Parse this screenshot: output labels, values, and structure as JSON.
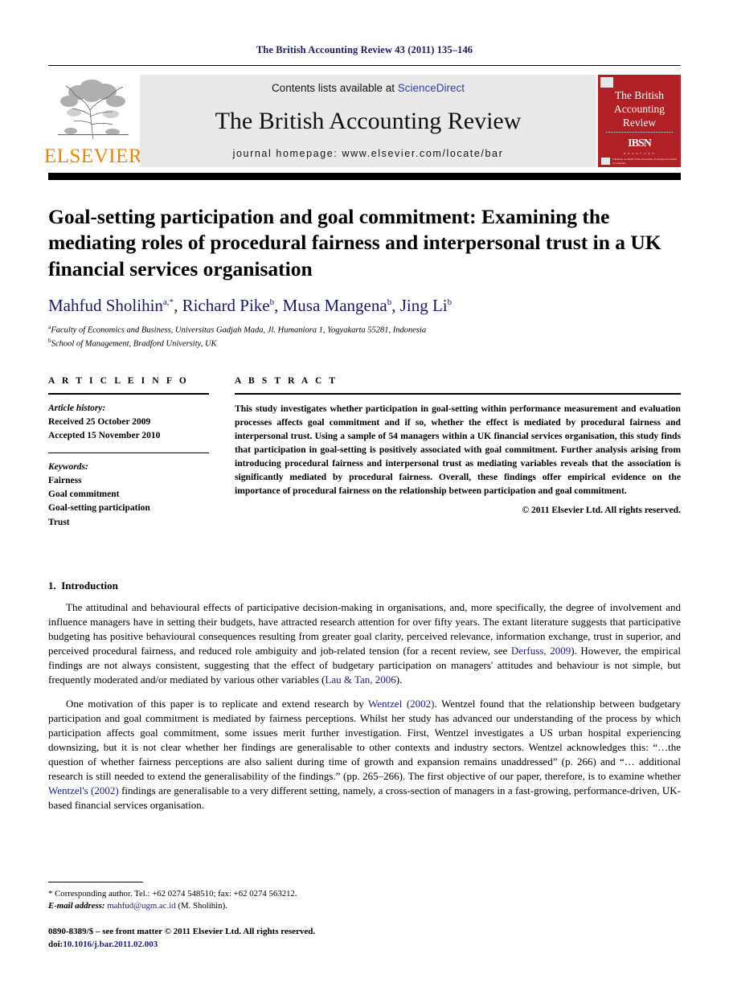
{
  "running_head": "The British Accounting Review 43 (2011) 135–146",
  "masthead": {
    "publisher_logo_text": "ELSEVIER",
    "contents_line_prefix": "Contents lists available at ",
    "contents_link": "ScienceDirect",
    "journal_title": "The British Accounting Review",
    "homepage_line": "journal homepage: www.elsevier.com/locate/bar",
    "cover": {
      "title_line1": "The British",
      "title_line2": "Accounting",
      "title_line3": "Review",
      "logo_text": "IBSN",
      "logo_sub": "B R A D F O R D",
      "footer_text": "Published on behalf of the association of Chartered Certified Accountants"
    }
  },
  "article": {
    "title": "Goal-setting participation and goal commitment: Examining the mediating roles of procedural fairness and interpersonal trust in a UK financial services organisation",
    "authors": [
      {
        "name": "Mahfud Sholihin",
        "marks": "a,*"
      },
      {
        "name": "Richard Pike",
        "marks": "b"
      },
      {
        "name": "Musa Mangena",
        "marks": "b"
      },
      {
        "name": "Jing Li",
        "marks": "b"
      }
    ],
    "affiliations": [
      {
        "mark": "a",
        "text": "Faculty of Economics and Business, Universitas Gadjah Mada, Jl. Humaniora 1, Yogyakarta 55281, Indonesia"
      },
      {
        "mark": "b",
        "text": "School of Management, Bradford University, UK"
      }
    ]
  },
  "info": {
    "label": "A R T I C L E   I N F O",
    "history_heading": "Article history:",
    "received": "Received 25 October 2009",
    "accepted": "Accepted 15 November 2010",
    "keywords_heading": "Keywords:",
    "keywords": [
      "Fairness",
      "Goal commitment",
      "Goal-setting participation",
      "Trust"
    ]
  },
  "abstract": {
    "label": "A B S T R A C T",
    "text": "This study investigates whether participation in goal-setting within performance measurement and evaluation processes affects goal commitment and if so, whether the effect is mediated by procedural fairness and interpersonal trust. Using a sample of 54 managers within a UK financial services organisation, this study finds that participation in goal-setting is positively associated with goal commitment. Further analysis arising from introducing procedural fairness and interpersonal trust as mediating variables reveals that the association is significantly mediated by procedural fairness. Overall, these findings offer empirical evidence on the importance of procedural fairness on the relationship between participation and goal commitment.",
    "copyright": "© 2011 Elsevier Ltd. All rights reserved."
  },
  "body": {
    "section_number": "1.",
    "section_title": "Introduction",
    "para1_a": "The attitudinal and behavioural effects of participative decision-making in organisations, and, more specifically, the degree of involvement and influence managers have in setting their budgets, have attracted research attention for over fifty years. The extant literature suggests that participative budgeting has positive behavioural consequences resulting from greater goal clarity, perceived relevance, information exchange, trust in superior, and perceived procedural fairness, and reduced role ambiguity and job-related tension (for a recent review, see ",
    "para1_cite1": "Derfuss, 2009",
    "para1_b": "). However, the empirical findings are not always consistent, suggesting that the effect of budgetary participation on managers' attitudes and behaviour is not simple, but frequently moderated and/or mediated by various other variables (",
    "para1_cite2": "Lau & Tan, 2006",
    "para1_c": ").",
    "para2_a": "One motivation of this paper is to replicate and extend research by ",
    "para2_cite1": "Wentzel (2002)",
    "para2_b": ". Wentzel found that the relationship between budgetary participation and goal commitment is mediated by fairness perceptions. Whilst her study has advanced our understanding of the process by which participation affects goal commitment, some issues merit further investigation. First, Wentzel investigates a US urban hospital experiencing downsizing, but it is not clear whether her findings are generalisable to other contexts and industry sectors. Wentzel acknowledges this: “…the question of whether fairness perceptions are also salient during time of growth and expansion remains unaddressed” (p. 266) and “… additional research is still needed to extend the generalisability of the findings.” (pp. 265–266). The first objective of our paper, therefore, is to examine whether ",
    "para2_cite2": "Wentzel's (2002)",
    "para2_c": " findings are generalisable to a very different setting, namely, a cross-section of managers in a fast-growing, performance-driven, UK-based financial services organisation."
  },
  "footnotes": {
    "corresponding": "* Corresponding author. Tel.: +62 0274 548510; fax: +62 0274 563212.",
    "email_label": "E-mail address:",
    "email": "mahfud@ugm.ac.id",
    "email_suffix": "(M. Sholihin).",
    "issn_line": "0890-8389/$ – see front matter © 2011 Elsevier Ltd. All rights reserved.",
    "doi_label": "doi:",
    "doi": "10.1016/j.bar.2011.02.003"
  },
  "colors": {
    "journal_navy": "#1a1a6e",
    "link_blue": "#1a1a8c",
    "elsevier_orange": "#ef8200",
    "cover_red": "#b02024",
    "banner_grey": "#e9e9e9"
  }
}
